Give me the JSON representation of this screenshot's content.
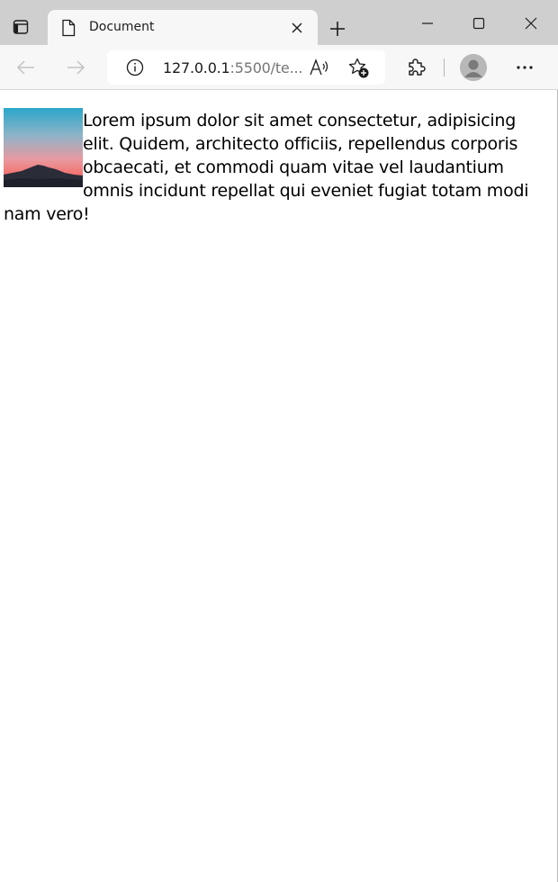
{
  "browser": {
    "tab": {
      "title": "Document"
    },
    "address_bar": {
      "host": "127.0.0.1",
      "rest": ":5500/te..."
    },
    "icons": {
      "tab_actions": "tab-actions-icon",
      "favicon": "document-icon",
      "tab_close": "close-icon",
      "new_tab": "plus-icon",
      "minimize": "minimize-icon",
      "maximize": "maximize-icon",
      "close_window": "close-icon",
      "back": "arrow-left-icon",
      "forward": "arrow-right-icon",
      "site_info": "info-icon",
      "read_aloud": "read-aloud-icon",
      "favorites": "star-add-icon",
      "extensions": "puzzle-icon",
      "profile": "user-avatar-icon",
      "more": "ellipsis-icon"
    }
  },
  "page": {
    "paragraph": "Lorem ipsum dolor sit amet consectetur, adipisicing elit. Quidem, architecto officiis, repellendus corporis obcaecati, et commodi quam vitae vel laudantium omnis incidunt repellat qui eveniet fugiat totam modi nam vero!",
    "image": {
      "description_icon": "landscape-photo"
    }
  },
  "colors": {
    "titlebar": "#cfcfcf",
    "toolbar": "#f7f7f7",
    "page_background": "#ffffff",
    "text": "#000000"
  }
}
